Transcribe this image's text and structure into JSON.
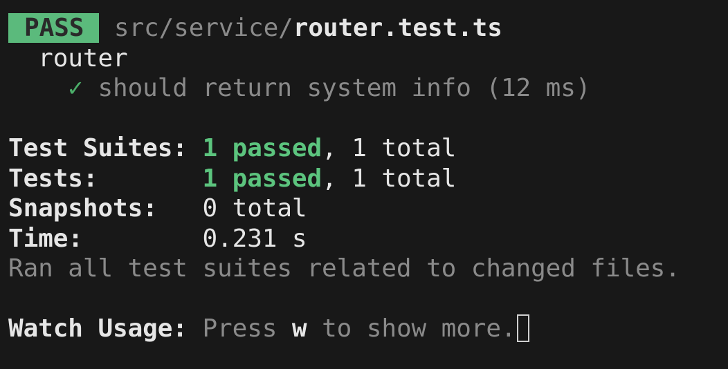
{
  "header": {
    "badge": "PASS",
    "file_dir": "src/service/",
    "file_name": "router.test.ts"
  },
  "suite": {
    "name": "router",
    "tests": [
      {
        "status_icon": "check-icon",
        "status_glyph": "✓",
        "name": "should return system info",
        "duration": "(12 ms)"
      }
    ]
  },
  "summary": {
    "test_suites": {
      "label": "Test Suites:",
      "passed": "1 passed",
      "rest": ", 1 total"
    },
    "tests": {
      "label": "Tests:",
      "passed": "1 passed",
      "rest": ", 1 total"
    },
    "snapshots": {
      "label": "Snapshots:",
      "value": "0 total"
    },
    "time": {
      "label": "Time:",
      "value": "0.231 s"
    },
    "note": "Ran all test suites related to changed files."
  },
  "watch": {
    "label": "Watch Usage:",
    "prefix": "Press ",
    "key": "w",
    "suffix": " to show more."
  },
  "colors": {
    "background": "#181818",
    "pass_badge": "#5bba7c",
    "passed_text": "#5cc47e",
    "dim_text": "#8a8a8a",
    "bright_text": "#e6e6e6"
  }
}
